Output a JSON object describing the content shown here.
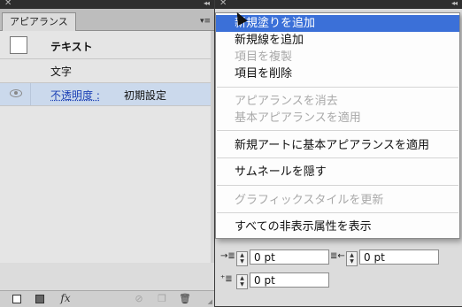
{
  "appearance_panel": {
    "title": "アピアランス",
    "object_name": "テキスト",
    "character_label": "文字",
    "opacity_label": "不透明度 :",
    "opacity_value": "初期設定",
    "footer_buttons": {
      "fx_label": "fx"
    }
  },
  "flyout_menu": {
    "items": [
      {
        "label": "新規塗りを追加",
        "enabled": true,
        "highlighted": true
      },
      {
        "label": "新規線を追加",
        "enabled": true
      },
      {
        "label": "項目を複製",
        "enabled": false
      },
      {
        "label": "項目を削除",
        "enabled": true
      },
      {
        "label": "アピアランスを消去",
        "enabled": false
      },
      {
        "label": "基本アピアランスを適用",
        "enabled": false
      },
      {
        "label": "新規アートに基本アピアランスを適用",
        "enabled": true
      },
      {
        "label": "サムネールを隠す",
        "enabled": true
      },
      {
        "label": "グラフィックスタイルを更新",
        "enabled": false
      },
      {
        "label": "すべての非表示属性を表示",
        "enabled": true
      }
    ]
  },
  "paragraph_panel": {
    "left_indent": "0 pt",
    "right_indent": "0 pt",
    "first_line_indent": "0 pt"
  },
  "colors": {
    "highlight": "#3b70d8",
    "selected_row": "#cbd9ec",
    "link": "#1a3fb5"
  }
}
